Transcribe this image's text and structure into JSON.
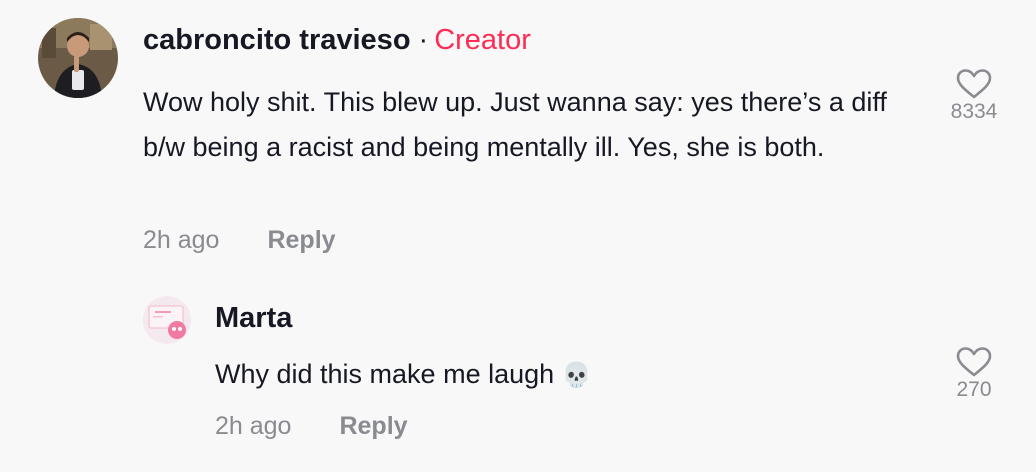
{
  "comments": [
    {
      "author": "cabroncito travieso",
      "separator": "·",
      "badge": "Creator",
      "text": "Wow holy shit. This blew up. Just wanna say: yes there’s a diff b/w being a racist and being mentally ill. Yes, she is both.",
      "time": "2h ago",
      "reply_label": "Reply",
      "likes": "8334",
      "avatar_icon": "profile-photo"
    }
  ],
  "replies": [
    {
      "author": "Marta",
      "text": "Why did this make me laugh",
      "emoji": "💀",
      "time": "2h ago",
      "reply_label": "Reply",
      "likes": "270",
      "avatar_icon": "profile-photo"
    }
  ],
  "colors": {
    "background": "#f8f8f8",
    "text": "#161823",
    "muted": "#8a8b91",
    "creator_badge": "#fe2c55"
  }
}
